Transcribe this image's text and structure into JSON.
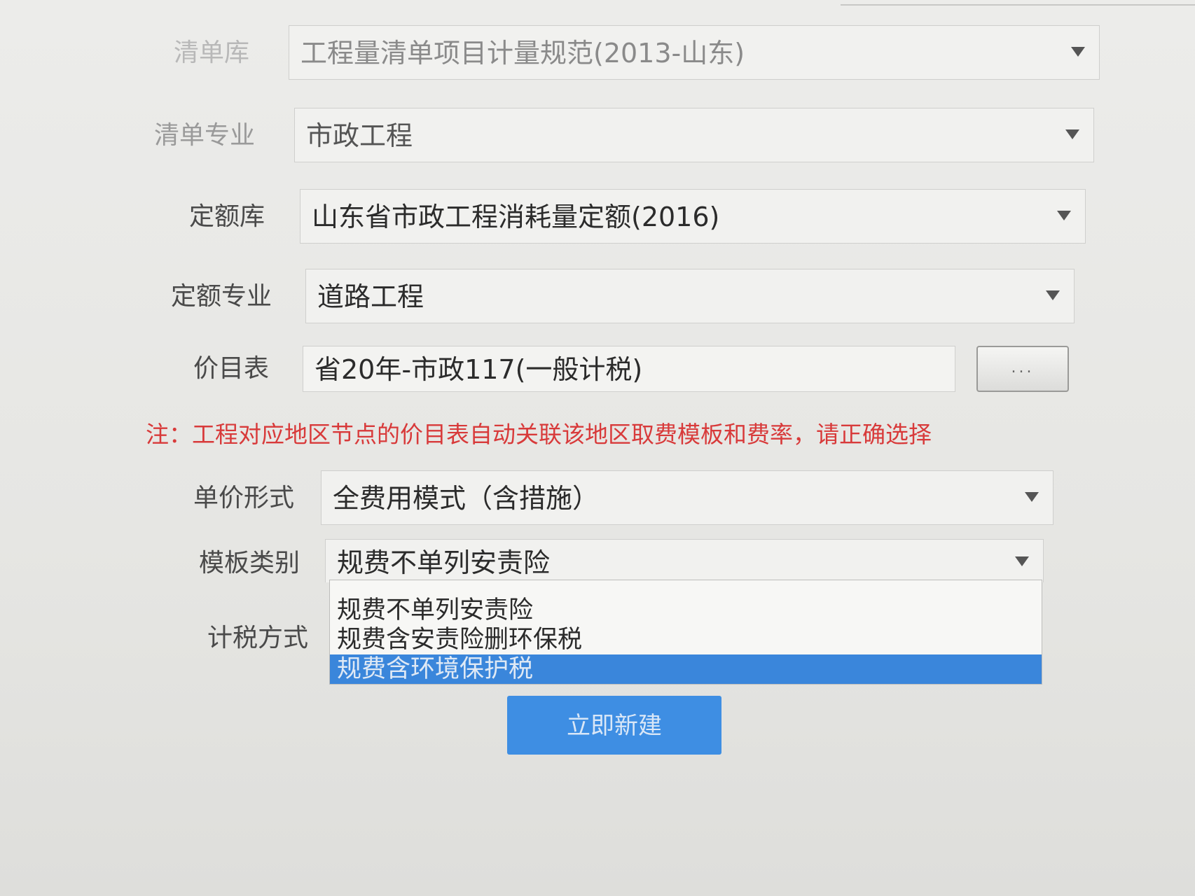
{
  "form": {
    "list_library": {
      "label": "清单库",
      "value": "工程量清单项目计量规范(2013-山东)"
    },
    "list_specialty": {
      "label": "清单专业",
      "value": "市政工程"
    },
    "quota_library": {
      "label": "定额库",
      "value": "山东省市政工程消耗量定额(2016)"
    },
    "quota_specialty": {
      "label": "定额专业",
      "value": "道路工程"
    },
    "price_table": {
      "label": "价目表",
      "value": "省20年-市政117(一般计税)",
      "browse_label": "..."
    },
    "note": "注：工程对应地区节点的价目表自动关联该地区取费模板和费率，请正确选择",
    "unit_price_form": {
      "label": "单价形式",
      "value": "全费用模式（含措施）"
    },
    "template_category": {
      "label": "模板类别",
      "value": "规费不单列安责险",
      "options": [
        "规费不单列安责险",
        "规费含安责险删环保税",
        "规费含环境保护税"
      ],
      "highlighted_index": 2
    },
    "tax_method": {
      "label": "计税方式"
    },
    "submit_label": "立即新建"
  }
}
